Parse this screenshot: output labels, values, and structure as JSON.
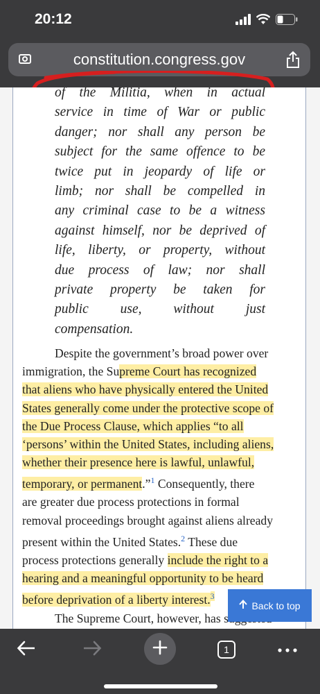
{
  "status_bar": {
    "time": "20:12"
  },
  "browser": {
    "url": "constitution.congress.gov",
    "tab_count": "1"
  },
  "colors": {
    "highlight": "#fde05a",
    "link": "#2a66c8",
    "annotation": "#d61f1f",
    "back_to_top_bg": "#3a78d6"
  },
  "article": {
    "quote_lines": [
      "of the Militia, when in actual",
      "service in time of War or public",
      "danger; nor shall any person be",
      "subject for the same offence to be",
      "twice put in jeopardy of life or",
      "limb; nor shall be compelled in",
      "any criminal case to be a witness",
      "against himself, nor be deprived of",
      "life, liberty, or property, without",
      "due process of law; nor shall",
      "private property be taken for",
      "public use, without just",
      "compensation."
    ],
    "para1": {
      "l1": "Despite the government’s broad power over",
      "l2a": "immigration, the Su",
      "l2b": "preme Court has recognized",
      "l3": "that aliens who have physically entered the United",
      "l4": "States generally come under the protective scope of",
      "l5": "the Due Process Clause, which applies “to all",
      "l6": "‘persons’ within the United States, including aliens,",
      "l7": "whether their presence here is lawful, unlawful,",
      "l8a": "temporary, or permanent",
      "l8b": ".”",
      "fn1": "1",
      "l8c": " Consequently, there",
      "l9": "are greater due process protections in formal",
      "l10": "removal proceedings brought against aliens already",
      "l11a": "present within the United States.",
      "fn2": "2",
      "l11b": " These due",
      "l12a": "process protections generally ",
      "l12b": "include the right to a",
      "l13": "hearing and a meaningful opportunity to be heard",
      "l14a": "before deprivation of a liberty interest.",
      "fn3": "3"
    },
    "para2_start": "The Supreme Court, however, has suggested"
  },
  "back_to_top": {
    "label": "Back to top",
    "icon": "arrow-up-icon"
  },
  "toolbar": {
    "icons": [
      "back-arrow-icon",
      "forward-arrow-icon",
      "plus-icon",
      "tabs-icon",
      "more-icon"
    ]
  }
}
